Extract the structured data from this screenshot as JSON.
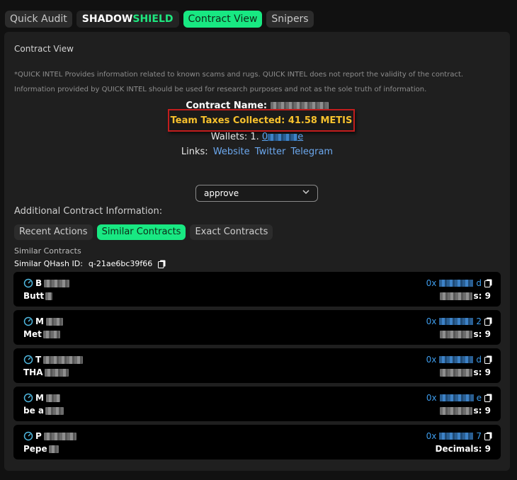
{
  "tabs": [
    {
      "label": "Quick Audit"
    },
    {
      "brand_part1": "SHADOW",
      "brand_part2": "SHIELD"
    },
    {
      "label": "Contract View"
    },
    {
      "label": "Snipers"
    }
  ],
  "panel": {
    "title": "Contract View",
    "disclaimer": "*QUICK INTEL Provides information related to known scams and rugs. QUICK INTEL does not report the validity of the contract. Information provided by QUICK INTEL should be used for research purposes and not as the sole truth of information.",
    "contract_name_label": "Contract Name:",
    "taxes_label": "Team Taxes Collected: 41.58 METIS",
    "wallets_label": "Wallets: 1.",
    "wallet_prefix": "0",
    "wallet_suffix": "e",
    "links_label": "Links:",
    "links": [
      "Website",
      "Twitter",
      "Telegram"
    ],
    "function_select": "approve",
    "additional_info_label": "Additional Contract Information:",
    "subtabs": [
      "Recent Actions",
      "Similar Contracts",
      "Exact Contracts"
    ],
    "similar_label": "Similar Contracts",
    "qhash_label": "Similar QHash ID:",
    "qhash_value": "q-21ae6bc39f66"
  },
  "cards": [
    {
      "name_start": "B",
      "symbol_start": "Butt",
      "addr_start": "0x",
      "addr_end": "d",
      "decimals_tail": "s: 9"
    },
    {
      "name_start": "M",
      "symbol_start": "Met",
      "addr_start": "0x",
      "addr_end": "2",
      "decimals_tail": "s: 9"
    },
    {
      "name_start": "T",
      "symbol_start": "THA",
      "addr_start": "0x",
      "addr_end": "d",
      "decimals_tail": "s: 9"
    },
    {
      "name_start": "M",
      "symbol_start": "be a",
      "addr_start": "0x",
      "addr_end": "e",
      "decimals_tail": "s: 9"
    },
    {
      "name_start": "P",
      "symbol_start": "Pepe",
      "addr_start": "0x",
      "addr_end": "7",
      "decimals_tail": "Decimals: 9"
    }
  ],
  "colors": {
    "accent": "#18e882",
    "taxes_text": "#f6c12d",
    "highlight_border": "#c21d1d",
    "link": "#5ea6f2"
  }
}
